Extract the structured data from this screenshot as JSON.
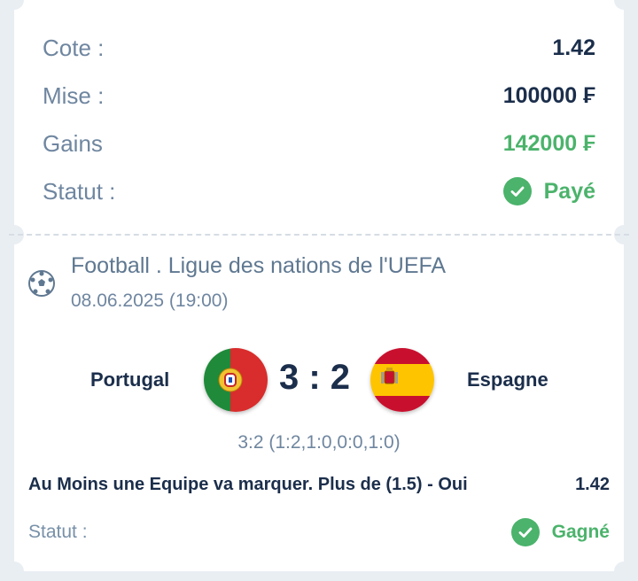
{
  "summary": {
    "odds_label": "Cote :",
    "odds_value": "1.42",
    "stake_label": "Mise :",
    "stake_value": "100000 ₣",
    "winnings_label": "Gains",
    "winnings_value": "142000 ₣",
    "status_label": "Statut :",
    "status_value": "Payé"
  },
  "event": {
    "sport_icon": "soccer-ball-icon",
    "league": "Football . Ligue des nations de l'UEFA",
    "datetime": "08.06.2025 (19:00)",
    "home_team": "Portugal",
    "away_team": "Espagne",
    "score": "3 : 2",
    "score_detail": "3:2 (1:2,1:0,0:0,1:0)",
    "market": "Au Moins une Equipe va marquer. Plus de (1.5) - Oui",
    "market_odds": "1.42",
    "status_label": "Statut :",
    "status_value": "Gagné"
  },
  "colors": {
    "accent_green": "#4bb36b",
    "text_dark": "#1b2e4b",
    "text_muted": "#6f86a0",
    "background": "#e9eef3"
  }
}
